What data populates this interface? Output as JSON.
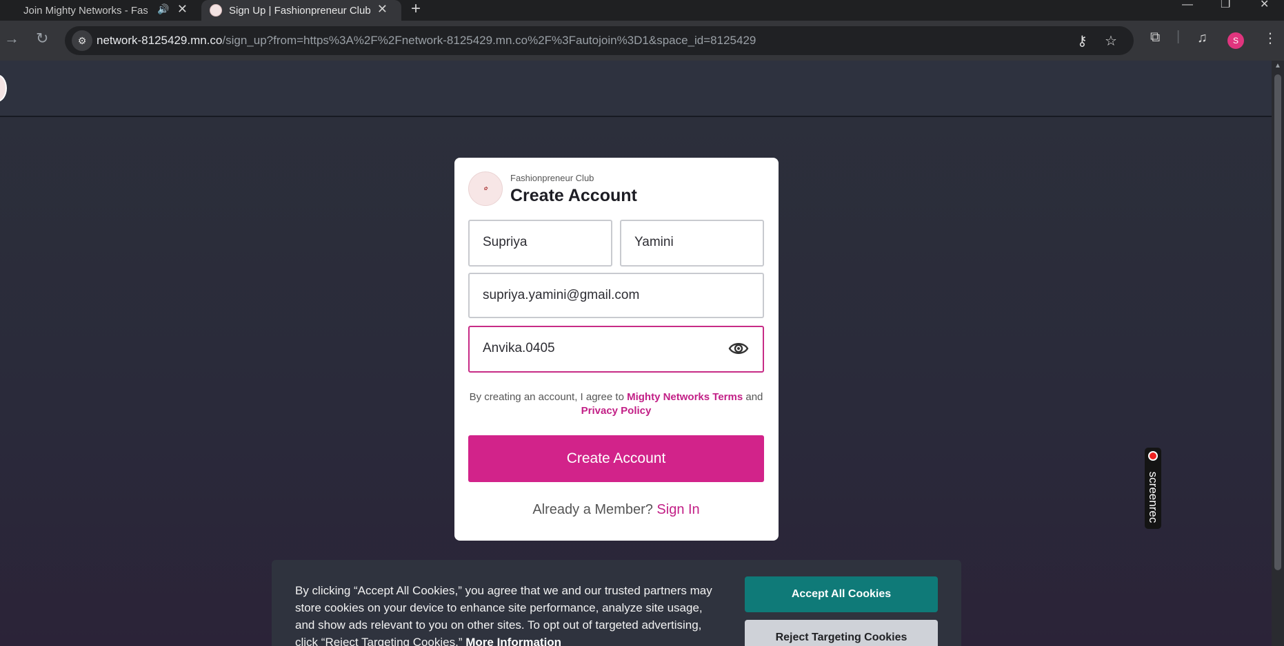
{
  "browser": {
    "tabs": [
      {
        "title": "Join Mighty Networks - Fashionpreneur Club",
        "close": "✕"
      },
      {
        "title": "Sign Up | Fashionpreneur Club",
        "close": "✕"
      }
    ],
    "new_tab": "+",
    "window_controls": {
      "minimize": "—",
      "restore": "❐",
      "close": "✕"
    },
    "url_host": "network-8125429.mn.co",
    "url_path": "/sign_up?from=https%3A%2F%2Fnetwork-8125429.mn.co%2F%3Fautojoin%3D1&space_id=8125429",
    "profile_initial": "S"
  },
  "signup": {
    "club_name": "Fashionpreneur Club",
    "title": "Create Account",
    "first_name": "Supriya",
    "last_name": "Yamini",
    "email": "supriya.yamini@gmail.com",
    "password": "Anvika.0405",
    "terms_prefix": "By creating an account, I agree to ",
    "terms_link": "Mighty Networks Terms",
    "terms_and": " and ",
    "privacy_link": "Privacy Policy",
    "create_button": "Create Account",
    "already_member": "Already a Member? ",
    "sign_in": "Sign In"
  },
  "cookie": {
    "text": "By clicking “Accept All Cookies,” you agree that we and our trusted partners may store cookies on your device to enhance site performance, analyze site usage, and show ads relevant to you on other sites. To opt out of targeted advertising, click “Reject Targeting Cookies.” ",
    "more_info": "More Information",
    "accept": "Accept All Cookies",
    "reject": "Reject Targeting Cookies"
  },
  "overlay": {
    "screenrec_label": "screenrec"
  },
  "colors": {
    "brand": "#d2238a",
    "accept": "#0f7a78",
    "focus_border": "#c72b86"
  }
}
